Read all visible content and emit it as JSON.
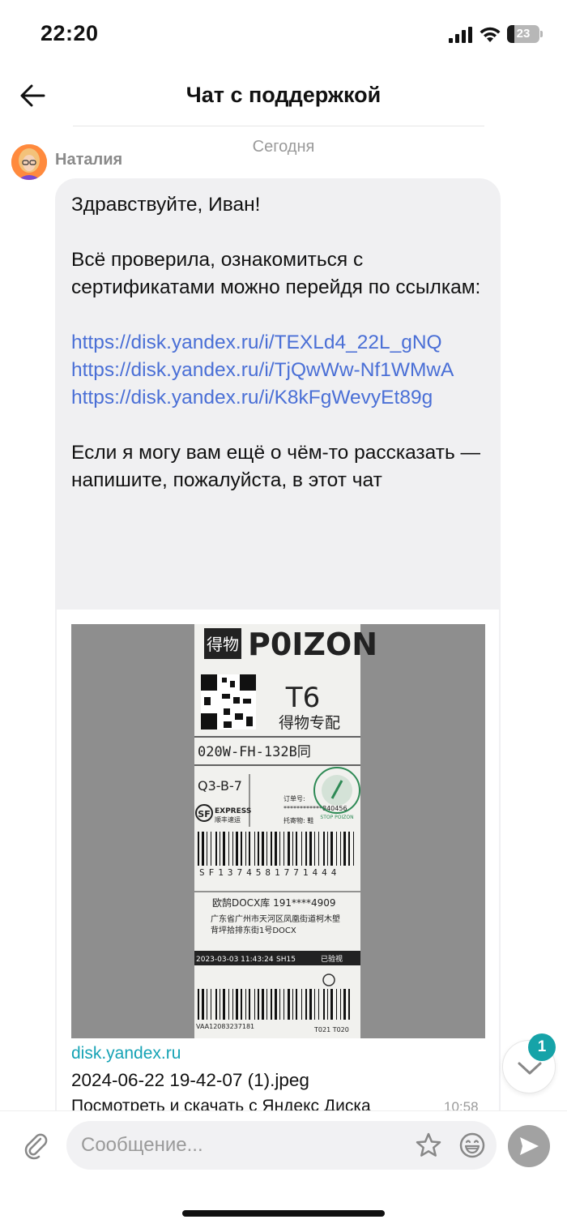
{
  "status_bar": {
    "time": "22:20",
    "battery": "23",
    "battery_level": 0.23
  },
  "header": {
    "title": "Чат с поддержкой"
  },
  "date_separator": "Сегодня",
  "sender": {
    "name": "Наталия"
  },
  "message": {
    "greeting": "Здравствуйте, Иван!",
    "body": "Всё проверила, ознакомиться с сертификатами можно перейдя по ссылкам:",
    "links": [
      "https://disk.yandex.ru/i/TEXLd4_22L_gNQ",
      "https://disk.yandex.ru/i/TjQwWw-Nf1WMwA",
      "https://disk.yandex.ru/i/K8kFgWevyEt89g"
    ],
    "closing": "Если я могу вам ещё о чём-то рассказать — напишите, пожалуйста, в этот чат",
    "time": "10:58"
  },
  "preview": {
    "domain": "disk.yandex.ru",
    "filename": "2024-06-22 19-42-07 (1).jpeg",
    "description": "Посмотреть и скачать с Яндекс Диска",
    "label": {
      "brand_cn": "得物",
      "brand": "P0IZON",
      "code": "T6",
      "subtitle": "得物专配",
      "route": "020W-FH-132B同",
      "sort": "Q3-B-7",
      "order_label": "订单号:",
      "order_no": "************840456",
      "goods_label": "托寄物: 鞋",
      "carrier_short": "SF",
      "carrier": "EXPRESS",
      "carrier_cn": "顺丰速运",
      "tracking": "SF1374581771444",
      "receiver": "欧鹄DOCX库  191****4909",
      "address1": "广东省广州市天河区凤凰街道柯木塱",
      "address2": "背坪拾排东街1号DOCX",
      "datetime": "2023-03-03 11:43:24",
      "station": "SH15",
      "check": "已验视",
      "stamp": "STOP POIZON",
      "barcode2": "VAA12083237181",
      "footer": "T021 T020"
    }
  },
  "scroll": {
    "unread": "1"
  },
  "composer": {
    "placeholder": "Сообщение..."
  }
}
